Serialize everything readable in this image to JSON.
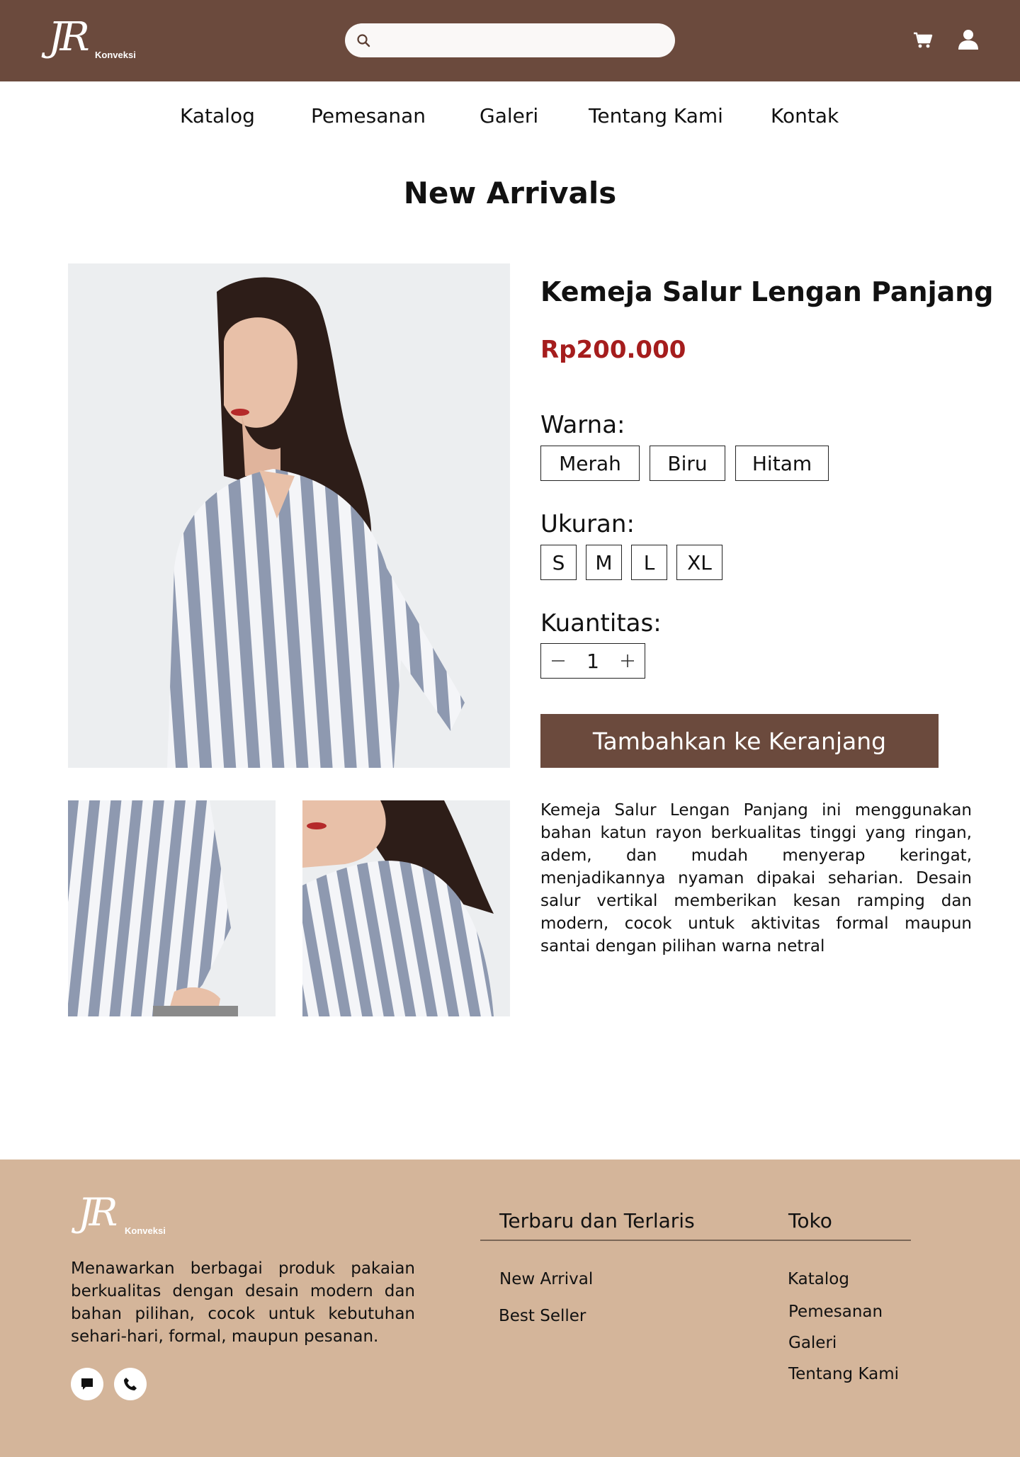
{
  "header": {
    "logo_monogram": "JR",
    "logo_sub": "Konveksi",
    "search_placeholder": "",
    "bg_color": "#6b4a3d"
  },
  "nav": {
    "items": [
      {
        "label": "Katalog"
      },
      {
        "label": "Pemesanan"
      },
      {
        "label": "Galeri"
      },
      {
        "label": "Tentang Kami"
      },
      {
        "label": "Kontak"
      }
    ]
  },
  "section": {
    "title": "New Arrivals"
  },
  "product": {
    "name": "Kemeja Salur Lengan Panjang",
    "price": "Rp200.000",
    "price_color": "#a51d1d",
    "color_label": "Warna:",
    "colors": [
      "Merah",
      "Biru",
      "Hitam"
    ],
    "size_label": "Ukuran:",
    "sizes": [
      "S",
      "M",
      "L",
      "XL"
    ],
    "quantity_label": "Kuantitas:",
    "quantity": "1",
    "add_to_cart": "Tambahkan ke Keranjang",
    "description": "Kemeja Salur Lengan Panjang ini menggunakan bahan katun rayon berkualitas tinggi yang ringan, adem, dan mudah menyerap keringat, menjadikannya nyaman dipakai seharian. Desain salur vertikal memberikan kesan ramping dan modern, cocok untuk aktivitas formal maupun santai dengan pilihan warna netral",
    "images": [
      "striped-shirt-model-main",
      "striped-shirt-sleeve-detail",
      "striped-shirt-collar-detail"
    ]
  },
  "footer": {
    "logo_monogram": "JR",
    "logo_sub": "Konveksi",
    "about": "Menawarkan berbagai produk pakaian berkualitas dengan desain modern dan bahan pilihan, cocok untuk kebutuhan sehari-hari, formal, maupun pesanan.",
    "social_icons": [
      "chat-icon",
      "phone-icon"
    ],
    "col1_title": "Terbaru dan Terlaris",
    "col1_links": [
      "New Arrival",
      "Best Seller"
    ],
    "col2_title": "Toko",
    "col2_links": [
      "Katalog",
      "Pemesanan",
      "Galeri",
      "Tentang Kami"
    ],
    "bg_color": "#d4b59a"
  }
}
